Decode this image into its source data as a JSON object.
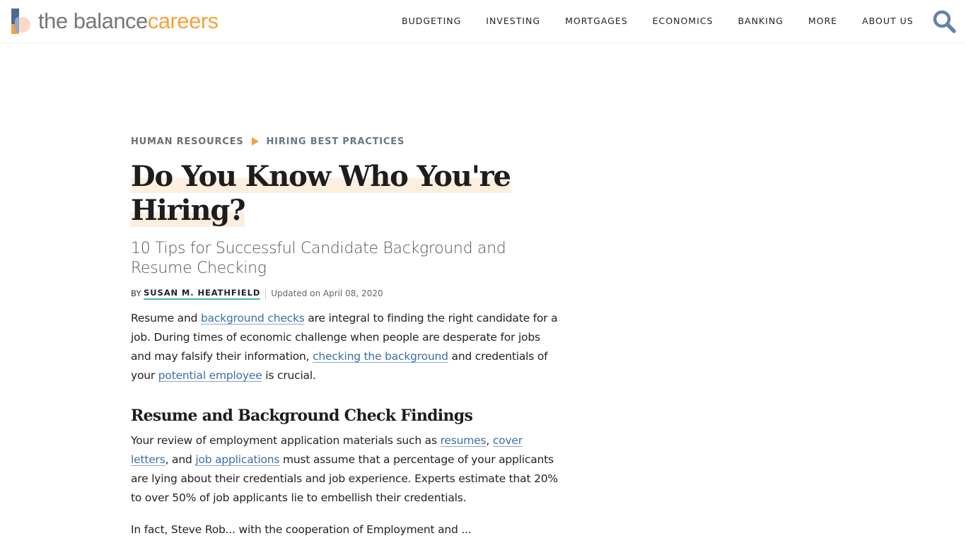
{
  "header": {
    "logo": {
      "part1": "the balance",
      "part2": "careers"
    },
    "nav": [
      "BUDGETING",
      "INVESTING",
      "MORTGAGES",
      "ECONOMICS",
      "BANKING",
      "MORE",
      "ABOUT US"
    ],
    "search_icon": "search-icon"
  },
  "article": {
    "breadcrumb": [
      "HUMAN RESOURCES",
      "HIRING BEST PRACTICES"
    ],
    "title": "Do You Know Who You're Hiring?",
    "subtitle": "10 Tips for Successful Candidate Background and Resume Checking",
    "byline": {
      "by": "BY",
      "author": "SUSAN M. HEATHFIELD",
      "updated": "Updated on April 08, 2020"
    },
    "p1": {
      "t1": "Resume and ",
      "l1": "background checks",
      "t2": " are integral to finding the right candidate for a job. During times of economic challenge when people are desperate for jobs and may falsify their information, ",
      "l2": "checking the background",
      "t3": " and credentials of your ",
      "l3": "potential employee",
      "t4": " is crucial."
    },
    "h2": "Resume and Background Check Findings",
    "p2": {
      "t1": "Your review of employment application materials such as ",
      "l1": "resumes",
      "t2": ", ",
      "l2": "cover letters",
      "t3": ", and ",
      "l3": "job applications",
      "t4": " must assume that a percentage of your applicants are lying about their credentials and job experience. Experts estimate that 20% to over 50% of job applicants lie to embellish their credentials."
    },
    "p3": "In fact, Steve Rob... with the cooperation of Employment and ..."
  }
}
